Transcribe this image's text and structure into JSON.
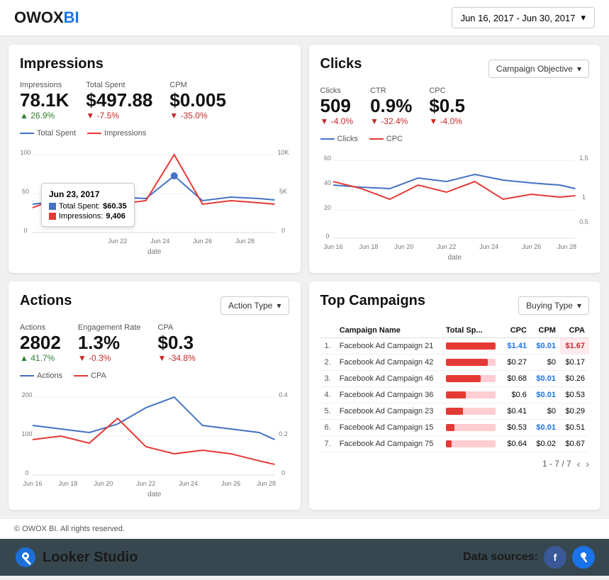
{
  "header": {
    "logo_text": "OWOX",
    "logo_bi": "BI",
    "date_range": "Jun 16, 2017 - Jun 30, 2017"
  },
  "impressions": {
    "title": "Impressions",
    "metrics": {
      "impressions_label": "Impressions",
      "impressions_value": "78.1K",
      "impressions_change": "26.9%",
      "impressions_dir": "up",
      "total_spent_label": "Total Spent",
      "total_spent_value": "$497.88",
      "total_spent_change": "-7.5%",
      "total_spent_dir": "down",
      "cpm_label": "CPM",
      "cpm_value": "$0.005",
      "cpm_change": "-35.0%",
      "cpm_dir": "down"
    },
    "legend": {
      "line1": "Total Spent",
      "line2": "Impressions"
    },
    "tooltip": {
      "date": "Jun 23, 2017",
      "total_spent_label": "Total Spent:",
      "total_spent_value": "$60.35",
      "impressions_label": "Impressions:",
      "impressions_value": "9,406"
    },
    "x_labels": [
      "Jun 22",
      "Jun 24",
      "Jun 26",
      "Jun 28"
    ],
    "date_axis": "date"
  },
  "clicks": {
    "title": "Clicks",
    "dropdown": "Campaign Objective",
    "metrics": {
      "clicks_label": "Clicks",
      "clicks_value": "509",
      "clicks_change": "-4.0%",
      "clicks_dir": "down",
      "ctr_label": "CTR",
      "ctr_value": "0.9%",
      "ctr_change": "-32.4%",
      "ctr_dir": "down",
      "cpc_label": "CPC",
      "cpc_value": "$0.5",
      "cpc_change": "-4.0%",
      "cpc_dir": "down"
    },
    "legend": {
      "line1": "Clicks",
      "line2": "CPC"
    },
    "x_labels": [
      "Jun 16",
      "Jun 18",
      "Jun 20",
      "Jun 22",
      "Jun 24",
      "Jun 26",
      "Jun 28"
    ],
    "date_axis": "date"
  },
  "actions": {
    "title": "Actions",
    "dropdown": "Action Type",
    "metrics": {
      "actions_label": "Actions",
      "actions_value": "2802",
      "actions_change": "41.7%",
      "actions_dir": "up",
      "engagement_label": "Engagement Rate",
      "engagement_value": "1.3%",
      "engagement_change": "-0.3%",
      "engagement_dir": "down",
      "cpa_label": "CPA",
      "cpa_value": "$0.3",
      "cpa_change": "-34.8%",
      "cpa_dir": "down"
    },
    "legend": {
      "line1": "Actions",
      "line2": "CPA"
    },
    "x_labels": [
      "Jun 16",
      "Jun 18",
      "Jun 20",
      "Jun 22",
      "Jun 24",
      "Jun 26",
      "Jun 28"
    ],
    "date_axis": "date"
  },
  "top_campaigns": {
    "title": "Top Campaigns",
    "dropdown": "Buying Type",
    "columns": [
      "",
      "Campaign Name",
      "Total Sp...",
      "CPC",
      "CPM",
      "CPA"
    ],
    "rows": [
      {
        "rank": "1.",
        "name": "Facebook Ad Campaign 21",
        "bar_pct": 100,
        "cpc": "$1.41",
        "cpm": "$0.01",
        "cpa": "$1.67",
        "cpa_highlight": true
      },
      {
        "rank": "2.",
        "name": "Facebook Ad Campaign 42",
        "bar_pct": 85,
        "cpc": "$0.27",
        "cpm": "$0",
        "cpa": "$0.17",
        "cpa_highlight": false
      },
      {
        "rank": "3.",
        "name": "Facebook Ad Campaign 46",
        "bar_pct": 70,
        "cpc": "$0.68",
        "cpm": "$0.01",
        "cpa": "$0.26",
        "cpa_highlight": false
      },
      {
        "rank": "4.",
        "name": "Facebook Ad Campaign 36",
        "bar_pct": 40,
        "cpc": "$0.6",
        "cpm": "$0.01",
        "cpa": "$0.53",
        "cpa_highlight": false
      },
      {
        "rank": "5.",
        "name": "Facebook Ad Campaign 23",
        "bar_pct": 35,
        "cpc": "$0.41",
        "cpm": "$0",
        "cpa": "$0.29",
        "cpa_highlight": false
      },
      {
        "rank": "6.",
        "name": "Facebook Ad Campaign 15",
        "bar_pct": 18,
        "cpc": "$0.53",
        "cpm": "$0.01",
        "cpa": "$0.51",
        "cpa_highlight": false
      },
      {
        "rank": "7.",
        "name": "Facebook Ad Campaign 75",
        "bar_pct": 12,
        "cpc": "$0.64",
        "cpm": "$0.02",
        "cpa": "$0.67",
        "cpa_highlight": false
      }
    ],
    "pagination": "1 - 7 / 7"
  },
  "footer_copy": "© OWOX BI. All rights reserved.",
  "looker_label": "Looker Studio",
  "data_sources_label": "Data sources:"
}
